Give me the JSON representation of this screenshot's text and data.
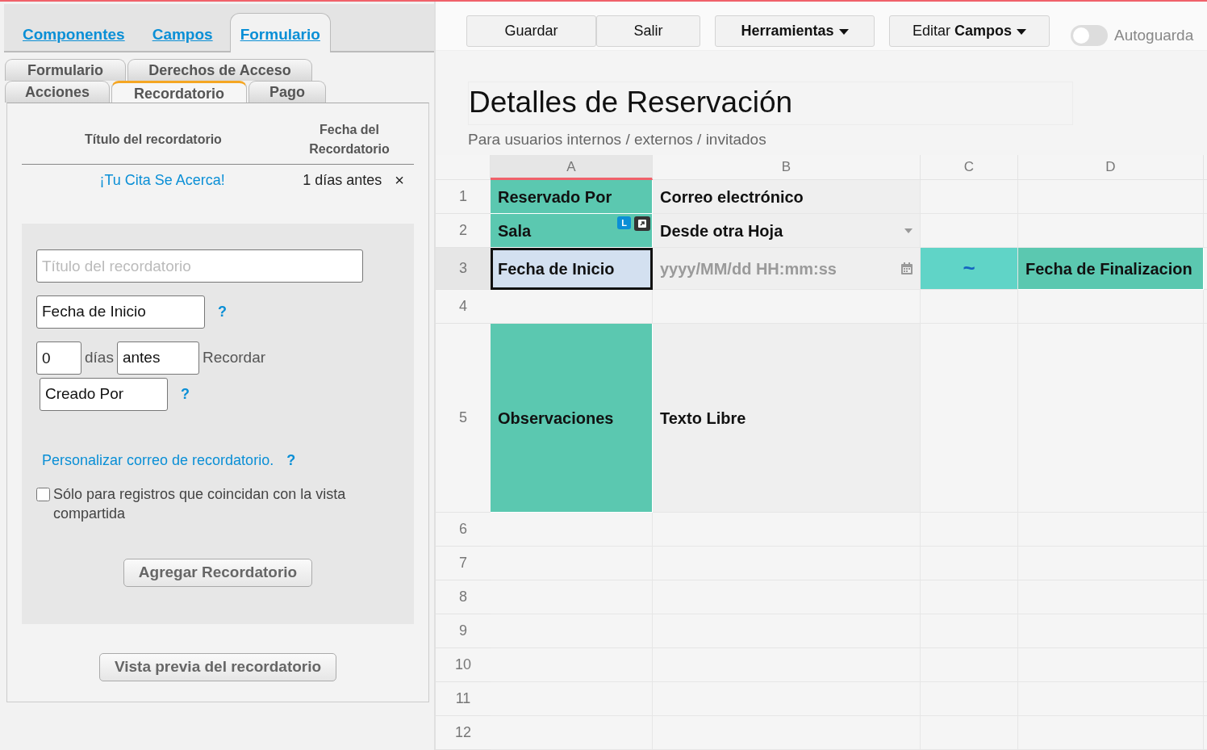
{
  "top_tabs": [
    {
      "label": "Componentes",
      "selected": false
    },
    {
      "label": "Campos",
      "selected": false
    },
    {
      "label": "Formulario",
      "selected": true
    }
  ],
  "sub_tab_rows": [
    {
      "tabs": [
        {
          "label": "Formulario",
          "selected": false
        },
        {
          "label": "Derechos de Acceso",
          "selected": false
        }
      ]
    },
    {
      "tabs": [
        {
          "label": "Acciones",
          "selected": false
        },
        {
          "label": "Recordatorio",
          "selected": true
        },
        {
          "label": "Pago",
          "selected": false
        }
      ]
    }
  ],
  "reminders": {
    "columns": [
      "Título del recordatorio",
      "Fecha del Recordatorio"
    ],
    "rows": [
      {
        "title": "¡Tu Cita Se Acerca!",
        "date": "1 días antes",
        "remove": "×"
      }
    ]
  },
  "form": {
    "title_field": {
      "placeholder": "Título del recordatorio"
    },
    "date_field": {
      "value": "Fecha de Inicio",
      "help": "?"
    },
    "offset": {
      "days": "0",
      "days_label": "días",
      "direction": "antes",
      "suffix": "Recordar"
    },
    "recipient": {
      "value": "Creado Por",
      "help": "?"
    },
    "customize_link": "Personalizar correo de recordatorio.",
    "customize_help": "?",
    "shared_view_only": {
      "label": "Sólo para registros que coincidan con la vista compartida",
      "checked": false
    },
    "add_button": "Agregar Recordatorio"
  },
  "preview_button": "Vista previa del recordatorio",
  "toolbar": {
    "buttons": [
      {
        "label": "Guardar",
        "kind": "plain",
        "bold": false
      },
      {
        "label": "Salir",
        "kind": "plain",
        "bold": false
      },
      {
        "label": "Herramientas",
        "kind": "menu",
        "bold": true
      },
      {
        "label": "Editar **Campos**",
        "kind": "menu",
        "bold": false
      }
    ],
    "autosave": {
      "label": "Autoguarda",
      "on": false
    }
  },
  "sheet": {
    "title": "Detalles de Reservación",
    "subtitle": "Para usuarios internos / externos / invitados",
    "columns": [
      {
        "label": "A",
        "selected": true
      },
      {
        "label": "B",
        "selected": false
      },
      {
        "label": "C",
        "selected": false
      },
      {
        "label": "D",
        "selected": false
      }
    ],
    "rows": [
      {
        "number": "1",
        "selected": false,
        "cells": [
          {
            "kind": "label",
            "text": "Reservado Por",
            "selected": false
          },
          {
            "kind": "text",
            "text": "Correo electrónico",
            "selected": false
          },
          {
            "kind": "empty"
          },
          {
            "kind": "empty"
          }
        ]
      },
      {
        "number": "2",
        "selected": false,
        "cells": [
          {
            "kind": "label",
            "text": "Sala",
            "badge": "L",
            "selected": false
          },
          {
            "kind": "select",
            "text": "Desde otra Hoja",
            "selected": false
          },
          {
            "kind": "empty"
          },
          {
            "kind": "empty"
          }
        ]
      },
      {
        "number": "3",
        "selected": true,
        "cells": [
          {
            "kind": "label",
            "text": "Fecha de Inicio",
            "selected": true
          },
          {
            "kind": "date",
            "placeholder": "yyyy/MM/dd HH:mm:ss",
            "selected": false
          },
          {
            "kind": "tilde",
            "text": "~",
            "selected": false
          },
          {
            "kind": "label",
            "text": "Fecha de Finalizacion",
            "selected": false
          }
        ]
      },
      {
        "number": "4",
        "selected": false,
        "cells": [
          {
            "kind": "empty"
          },
          {
            "kind": "empty"
          },
          {
            "kind": "empty"
          },
          {
            "kind": "empty"
          }
        ]
      },
      {
        "number": "5",
        "selected": false,
        "cells": [
          {
            "kind": "label",
            "text": "Observaciones",
            "selected": false
          },
          {
            "kind": "memo",
            "text": "Texto Libre",
            "selected": false
          },
          {
            "kind": "empty"
          },
          {
            "kind": "empty"
          }
        ]
      },
      {
        "number": "6",
        "selected": false,
        "cells": [
          {
            "kind": "empty"
          },
          {
            "kind": "empty"
          },
          {
            "kind": "empty"
          },
          {
            "kind": "empty"
          }
        ]
      },
      {
        "number": "7",
        "selected": false,
        "cells": [
          {
            "kind": "empty"
          },
          {
            "kind": "empty"
          },
          {
            "kind": "empty"
          },
          {
            "kind": "empty"
          }
        ]
      },
      {
        "number": "8",
        "selected": false,
        "cells": [
          {
            "kind": "empty"
          },
          {
            "kind": "empty"
          },
          {
            "kind": "empty"
          },
          {
            "kind": "empty"
          }
        ]
      },
      {
        "number": "9",
        "selected": false,
        "cells": [
          {
            "kind": "empty"
          },
          {
            "kind": "empty"
          },
          {
            "kind": "empty"
          },
          {
            "kind": "empty"
          }
        ]
      },
      {
        "number": "10",
        "selected": false,
        "cells": [
          {
            "kind": "empty"
          },
          {
            "kind": "empty"
          },
          {
            "kind": "empty"
          },
          {
            "kind": "empty"
          }
        ]
      },
      {
        "number": "11",
        "selected": false,
        "cells": [
          {
            "kind": "empty"
          },
          {
            "kind": "empty"
          },
          {
            "kind": "empty"
          },
          {
            "kind": "empty"
          }
        ]
      },
      {
        "number": "12",
        "selected": false,
        "cells": [
          {
            "kind": "empty"
          },
          {
            "kind": "empty"
          },
          {
            "kind": "empty"
          },
          {
            "kind": "empty"
          }
        ]
      }
    ]
  }
}
